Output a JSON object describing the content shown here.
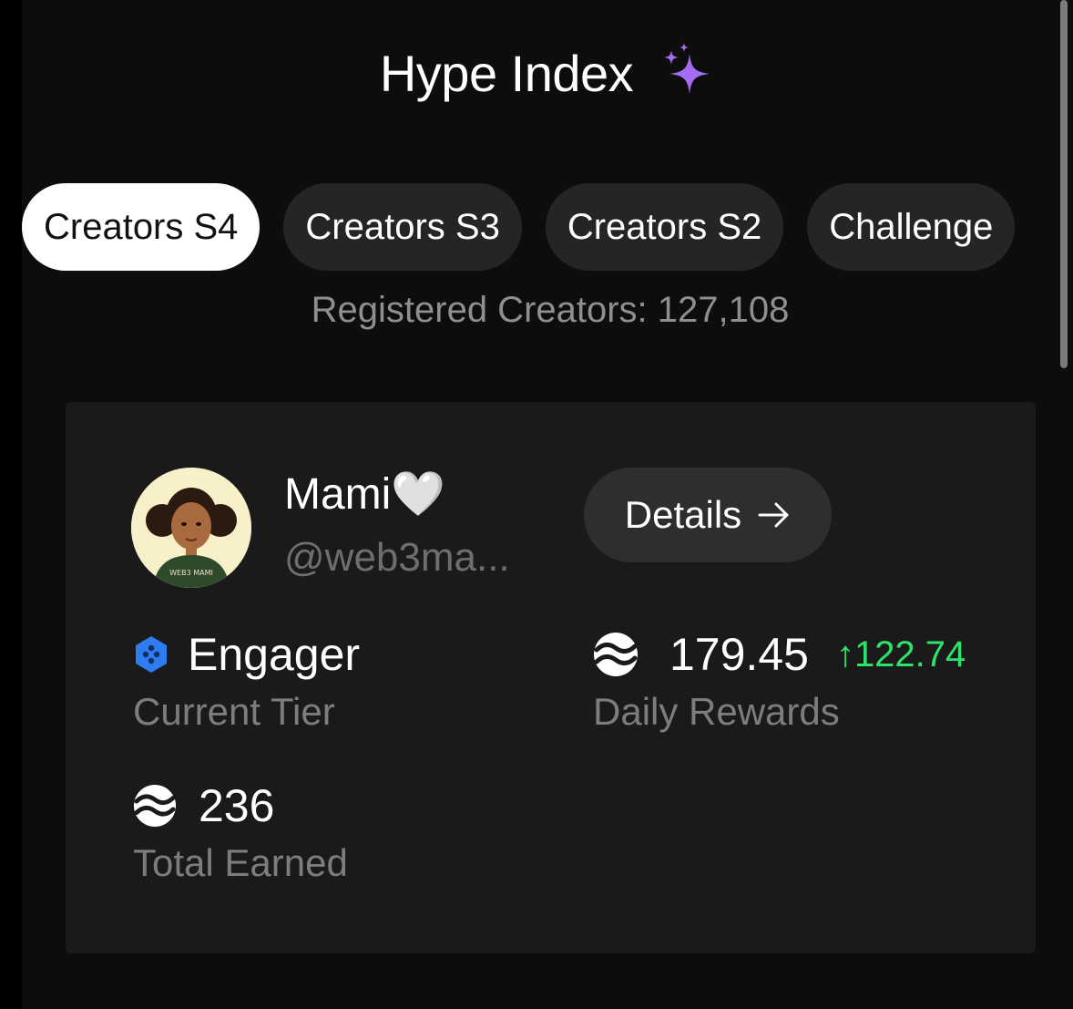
{
  "header": {
    "title": "Hype Index"
  },
  "tabs": [
    {
      "label": "Creators S4",
      "active": true
    },
    {
      "label": "Creators S3",
      "active": false
    },
    {
      "label": "Creators S2",
      "active": false
    },
    {
      "label": "Challenge",
      "active": false
    }
  ],
  "registered_text": "Registered Creators: 127,108",
  "profile": {
    "name": "Mami🤍",
    "handle": "@web3ma...",
    "details_label": "Details",
    "avatar_text": "WEB3 MAMI"
  },
  "stats": {
    "tier": {
      "value": "Engager",
      "label": "Current Tier",
      "icon": "hexagon-tier-icon"
    },
    "daily": {
      "value": "179.45",
      "change": "122.74",
      "label": "Daily Rewards",
      "icon": "token-icon"
    },
    "total": {
      "value": "236",
      "label": "Total Earned",
      "icon": "token-icon"
    }
  },
  "colors": {
    "background": "#0d0d0d",
    "card": "#1a1a1a",
    "accent_sparkle": "#a56cf5",
    "positive": "#2ee36b",
    "tier_blue": "#2f7cf0"
  }
}
